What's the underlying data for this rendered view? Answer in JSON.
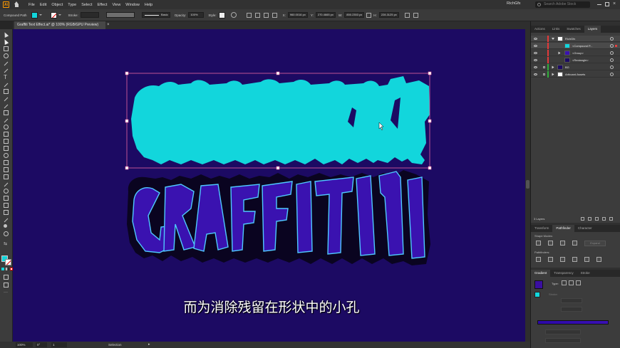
{
  "menubar": {
    "app_icon": "Ai",
    "items": [
      "File",
      "Edit",
      "Object",
      "Type",
      "Select",
      "Effect",
      "View",
      "Window",
      "Help"
    ],
    "workspace": "RichGfx",
    "search_placeholder": "Search Adobe Stock"
  },
  "controlbar": {
    "selection_type": "Compound Path",
    "stroke_label": "Stroke:",
    "brush_label": "Basic",
    "opacity_label": "Opacity:",
    "opacity_value": "100%",
    "style_label": "Style:",
    "x_label": "X:",
    "x_value": "960.0016 px",
    "y_label": "Y:",
    "y_value": "270.4665 px",
    "w_label": "W:",
    "w_value": "850.2353 px",
    "h_label": "H:",
    "h_value": "228.3125 px",
    "fill_color": "#12d6dc"
  },
  "document": {
    "tab_title": "Graffiti Text Effect.ai* @ 100% (RGB/GPU Preview)",
    "tab_close": "×",
    "canvas_color": "#1c0a63"
  },
  "artwork": {
    "solid_fill_color": "#12d6dc",
    "graffiti_text": "GRAFFITI",
    "graffiti_fill": "#3a12b0",
    "graffiti_outline": "#4fc8ff"
  },
  "subtitle": "而为消除残留在形状中的小孔",
  "statusbar": {
    "zoom": "100%",
    "angle": "0°",
    "artboard": "1",
    "mode": "Selection"
  },
  "panels": {
    "top_tabs": [
      "Actions",
      "Links",
      "Swatches",
      "Layers"
    ],
    "layers": [
      {
        "name": "RichGfx",
        "color": "#e23a3a",
        "level": 0,
        "expanded": true
      },
      {
        "name": "<Compound P...",
        "color": "#e23a3a",
        "level": 2
      },
      {
        "name": "<Group>",
        "color": "#e23a3a",
        "level": 1
      },
      {
        "name": "<Rectangle>",
        "color": "#e23a3a",
        "level": 1
      },
      {
        "name": "BG",
        "color": "#2fae3a",
        "level": 0,
        "locked": true
      },
      {
        "name": "Artboard Assets",
        "color": "#2fae3a",
        "level": 0,
        "locked": true
      }
    ],
    "layers_count": "3 Layers",
    "mid_tabs": [
      "Transform",
      "Pathfinder",
      "Character"
    ],
    "shape_modes_label": "Shape Modes:",
    "expand_label": "Expand",
    "pathfinders_label": "Pathfinders:",
    "bottom_tabs": [
      "Gradient",
      "Transparency",
      "Stroke"
    ],
    "gradient_type_label": "Type:",
    "gradient_stroke_label": "Stroke:",
    "gradient_color": "#3a0fa0"
  }
}
